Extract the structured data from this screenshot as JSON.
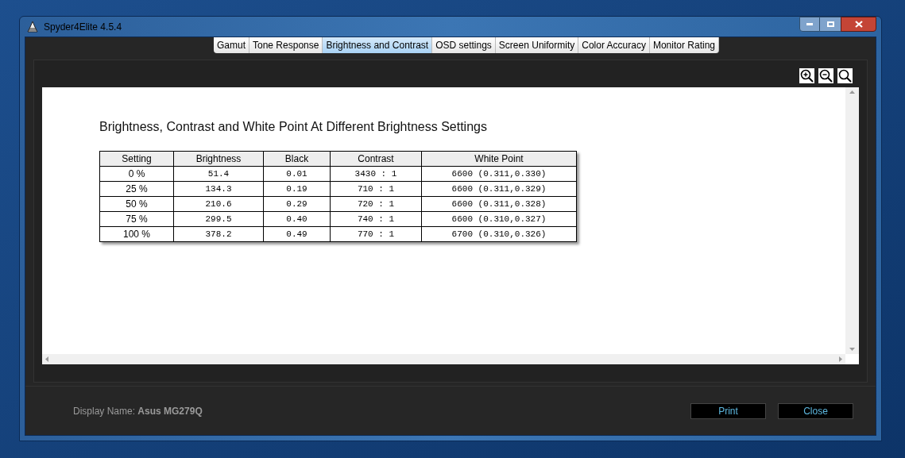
{
  "window": {
    "title": "Spyder4Elite 4.5.4"
  },
  "tabs": [
    {
      "label": "Gamut",
      "selected": false
    },
    {
      "label": "Tone Response",
      "selected": false
    },
    {
      "label": "Brightness and Contrast",
      "selected": true
    },
    {
      "label": "OSD settings",
      "selected": false
    },
    {
      "label": "Screen Uniformity",
      "selected": false
    },
    {
      "label": "Color Accuracy",
      "selected": false
    },
    {
      "label": "Monitor Rating",
      "selected": false
    }
  ],
  "report": {
    "title": "Brightness, Contrast and White Point At Different Brightness Settings",
    "table": {
      "columns": [
        "Setting",
        "Brightness",
        "Black",
        "Contrast",
        "White Point"
      ],
      "rows": [
        [
          "0 %",
          "51.4",
          "0.01",
          "3430 : 1",
          "6600 (0.311,0.330)"
        ],
        [
          "25 %",
          "134.3",
          "0.19",
          "710 : 1",
          "6600 (0.311,0.329)"
        ],
        [
          "50 %",
          "210.6",
          "0.29",
          "720 : 1",
          "6600 (0.311,0.328)"
        ],
        [
          "75 %",
          "299.5",
          "0.40",
          "740 : 1",
          "6600 (0.310,0.327)"
        ],
        [
          "100 %",
          "378.2",
          "0.49",
          "770 : 1",
          "6700 (0.310,0.326)"
        ]
      ]
    }
  },
  "footer": {
    "label": "Display Name: ",
    "value": "Asus MG279Q",
    "buttons": [
      "Print",
      "Close"
    ]
  }
}
